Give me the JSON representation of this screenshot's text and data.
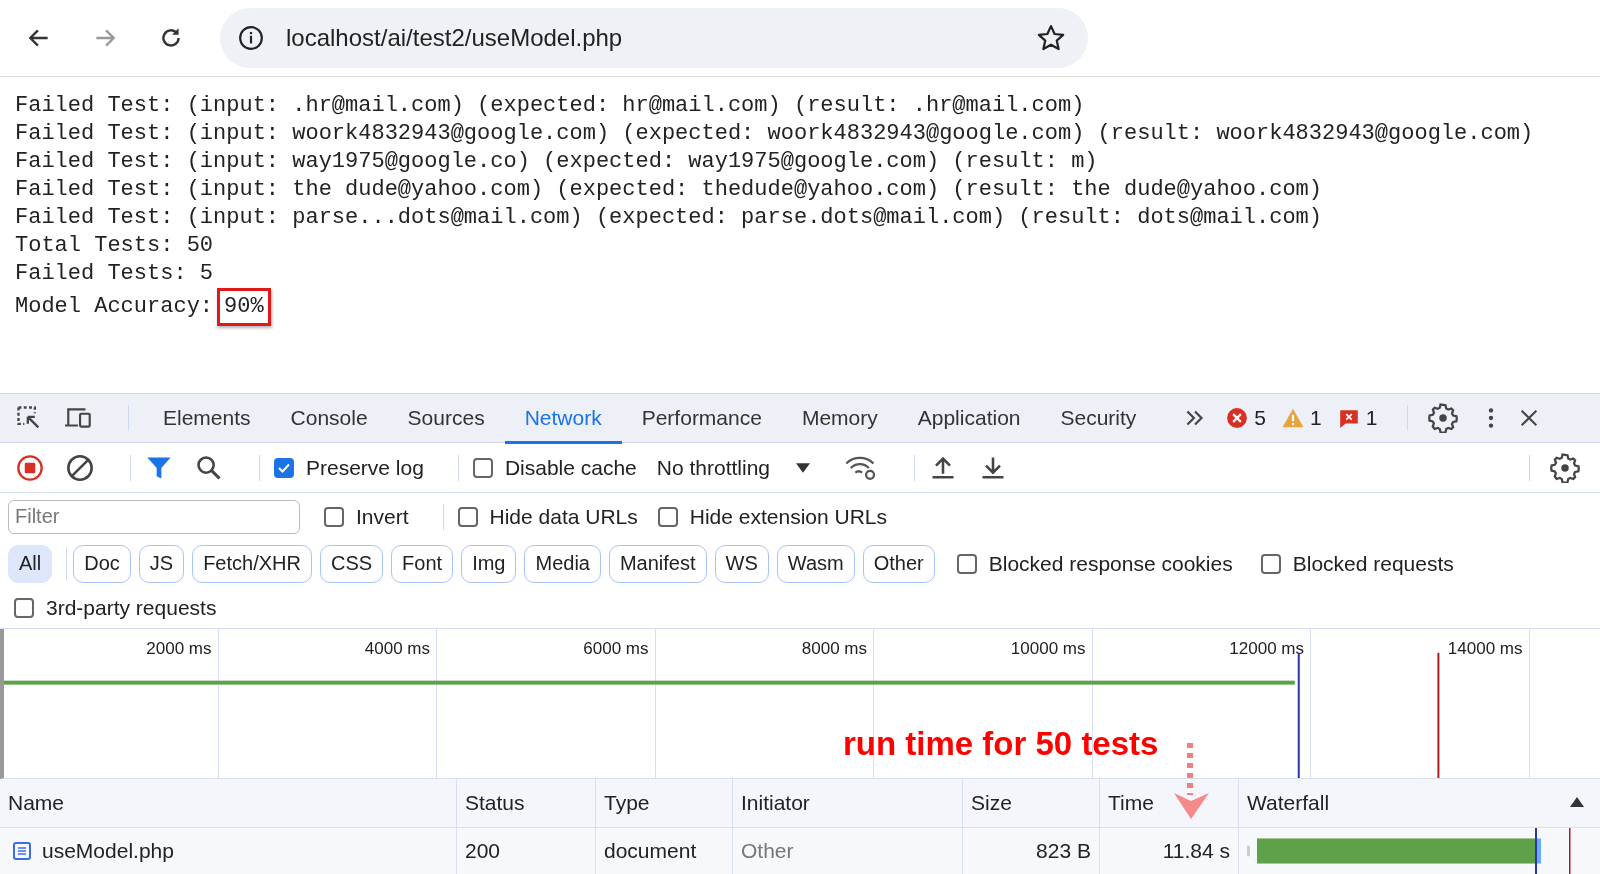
{
  "browser": {
    "url": "localhost/ai/test2/useModel.php"
  },
  "output": {
    "lines": [
      "Failed Test: (input: .hr@mail.com) (expected: hr@mail.com) (result: .hr@mail.com)",
      "Failed Test: (input: woork4832943@google.com) (expected: woork4832943@google.com) (result: woork4832943@google.com)",
      "Failed Test: (input: way1975@google.co) (expected: way1975@google.com) (result: m)",
      "Failed Test: (input: the dude@yahoo.com) (expected: thedude@yahoo.com) (result: the dude@yahoo.com)",
      "Failed Test: (input: parse...dots@mail.com) (expected: parse.dots@mail.com) (result: dots@mail.com)",
      "Total Tests: 50",
      "Failed Tests: 5"
    ],
    "accuracy": {
      "label": "Model Accuracy:",
      "value": "90%",
      "highlighted": true
    }
  },
  "devtools": {
    "tabs": [
      {
        "label": "Elements",
        "selected": false
      },
      {
        "label": "Console",
        "selected": false
      },
      {
        "label": "Sources",
        "selected": false
      },
      {
        "label": "Network",
        "selected": true
      },
      {
        "label": "Performance",
        "selected": false
      },
      {
        "label": "Memory",
        "selected": false
      },
      {
        "label": "Application",
        "selected": false
      },
      {
        "label": "Security",
        "selected": false
      }
    ],
    "counters": [
      {
        "kind": "error",
        "count": "5"
      },
      {
        "kind": "warning",
        "count": "1"
      },
      {
        "kind": "issue",
        "count": "1"
      }
    ],
    "toolbar": {
      "preserve_log": {
        "label": "Preserve log",
        "checked": true
      },
      "disable_cache": {
        "label": "Disable cache",
        "checked": false
      },
      "throttling": "No throttling"
    },
    "filter": {
      "placeholder": "Filter",
      "options": [
        {
          "label": "Invert",
          "checked": false
        },
        {
          "label": "Hide data URLs",
          "checked": false
        },
        {
          "label": "Hide extension URLs",
          "checked": false
        }
      ]
    },
    "types": [
      {
        "label": "All",
        "selected": true
      },
      {
        "label": "Doc",
        "selected": false
      },
      {
        "label": "JS",
        "selected": false
      },
      {
        "label": "Fetch/XHR",
        "selected": false
      },
      {
        "label": "CSS",
        "selected": false
      },
      {
        "label": "Font",
        "selected": false
      },
      {
        "label": "Img",
        "selected": false
      },
      {
        "label": "Media",
        "selected": false
      },
      {
        "label": "Manifest",
        "selected": false
      },
      {
        "label": "WS",
        "selected": false
      },
      {
        "label": "Wasm",
        "selected": false
      },
      {
        "label": "Other",
        "selected": false
      }
    ],
    "type_options": [
      {
        "label": "Blocked response cookies",
        "checked": false
      },
      {
        "label": "Blocked requests",
        "checked": false
      }
    ],
    "third_party": {
      "label": "3rd-party requests",
      "checked": false
    },
    "timeline": {
      "ticks": [
        "2000 ms",
        "4000 ms",
        "6000 ms",
        "8000 ms",
        "10000 ms",
        "12000 ms",
        "14000 ms"
      ]
    },
    "annotation": "run time for 50 tests",
    "table": {
      "columns": [
        "Name",
        "Status",
        "Type",
        "Initiator",
        "Size",
        "Time",
        "Waterfall"
      ],
      "rows": [
        {
          "name": "useModel.php",
          "status": "200",
          "type": "document",
          "initiator": "Other",
          "size": "823 B",
          "time": "11.84 s"
        }
      ]
    }
  }
}
